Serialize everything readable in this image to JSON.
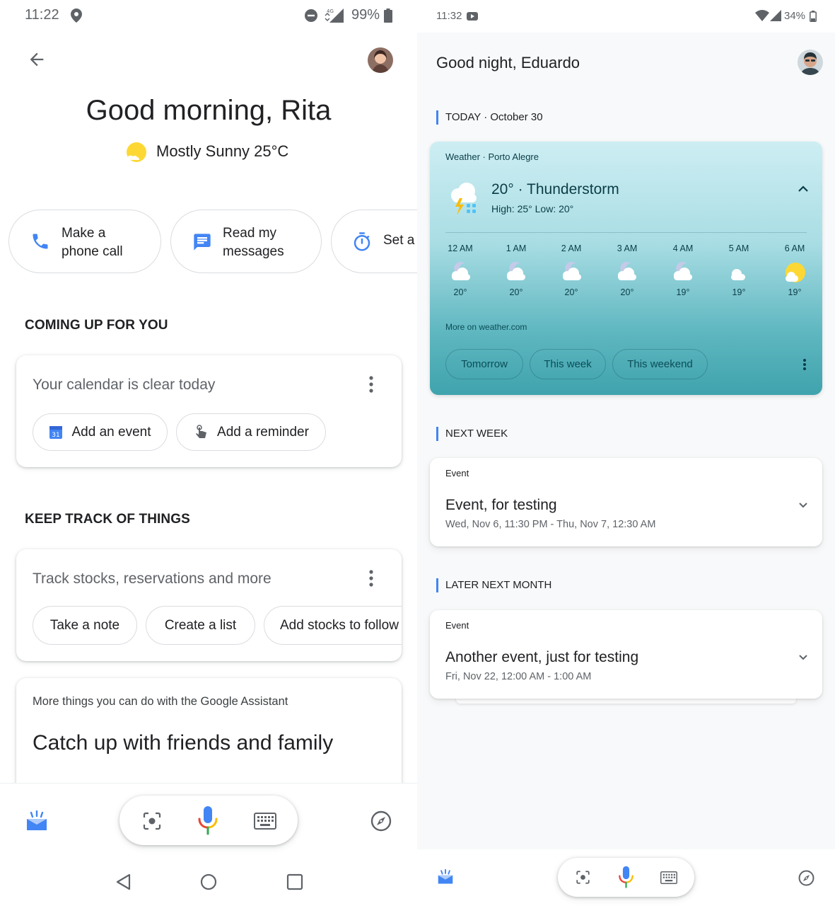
{
  "left": {
    "status": {
      "time": "11:22",
      "battery": "99%",
      "network": "4G"
    },
    "greeting": "Good morning, Rita",
    "weather": "Mostly Sunny 25°C",
    "quick_actions": [
      {
        "line1": "Make a",
        "line2": "phone call",
        "icon": "phone-icon"
      },
      {
        "line1": "Read my",
        "line2": "messages",
        "icon": "message-icon"
      },
      {
        "line1": "Set a",
        "icon": "timer-icon"
      }
    ],
    "coming_up": {
      "heading": "COMING UP FOR YOU",
      "card_title": "Your calendar is clear today",
      "add_event": "Add an event",
      "calendar_icon_text": "31",
      "add_reminder": "Add a reminder"
    },
    "keep_track": {
      "heading": "KEEP TRACK OF THINGS",
      "card_title": "Track stocks, reservations and more",
      "chips": [
        "Take a note",
        "Create a list",
        "Add stocks to follow"
      ]
    },
    "more": {
      "subtitle": "More things you can do with the Google Assistant",
      "title": "Catch up with friends and family"
    }
  },
  "right": {
    "status": {
      "time": "11:32",
      "battery": "34%"
    },
    "greeting": "Good night, Eduardo",
    "today": {
      "label": "TODAY",
      "date": " · October 30"
    },
    "weather_card": {
      "header": "Weather · Porto Alegre",
      "temp_condition": "20° · Thunderstorm",
      "high_low": "High: 25° Low: 20°",
      "hours": [
        {
          "time": "12 AM",
          "temp": "20°",
          "icon": "cloudy-night-icon"
        },
        {
          "time": "1 AM",
          "temp": "20°",
          "icon": "cloudy-night-icon"
        },
        {
          "time": "2 AM",
          "temp": "20°",
          "icon": "cloudy-night-icon"
        },
        {
          "time": "3 AM",
          "temp": "20°",
          "icon": "cloudy-night-icon"
        },
        {
          "time": "4 AM",
          "temp": "19°",
          "icon": "cloudy-night-icon"
        },
        {
          "time": "5 AM",
          "temp": "19°",
          "icon": "cloudy-night-icon"
        },
        {
          "time": "6 AM",
          "temp": "19°",
          "icon": "partly-sunny-icon"
        }
      ],
      "more_link": "More on weather.com",
      "chips": [
        "Tomorrow",
        "This week",
        "This weekend"
      ]
    },
    "next_week": {
      "label": "NEXT WEEK",
      "type": "Event",
      "title": "Event, for testing",
      "time": "Wed, Nov 6, 11:30 PM - Thu, Nov 7, 12:30 AM"
    },
    "later": {
      "label": "LATER NEXT MONTH",
      "type": "Event",
      "title": "Another event, just for testing",
      "time": "Fri, Nov 22, 12:00 AM - 1:00 AM"
    }
  },
  "colors": {
    "blue": "#4285f4",
    "red": "#ea4335",
    "yellow": "#fbbc04",
    "green": "#34a853",
    "weather_top": "#c7ebf1",
    "weather_bottom": "#3fa3ad"
  }
}
